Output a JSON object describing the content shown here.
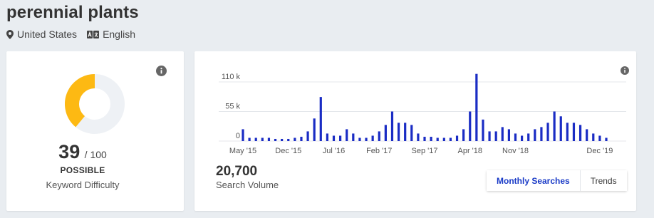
{
  "header": {
    "title": "perennial plants",
    "location": "United States",
    "language": "English"
  },
  "difficulty": {
    "score": "39",
    "out_of": "/ 100",
    "level": "POSSIBLE",
    "caption": "Keyword Difficulty",
    "value_fraction": 0.39,
    "colors": {
      "fill": "#fdb913",
      "track": "#eef1f5"
    }
  },
  "volume": {
    "value": "20,700",
    "caption": "Search Volume",
    "toggle": {
      "monthly_label": "Monthly Searches",
      "trends_label": "Trends",
      "active": "monthly"
    }
  },
  "chart_data": {
    "type": "bar",
    "color": "#1a2cc4",
    "yticks": [
      "110 k",
      "55 k",
      "0"
    ],
    "ytick_values": [
      110000,
      55000,
      0
    ],
    "ylim": [
      0,
      110000
    ],
    "xtick_labels": [
      "May '15",
      "Dec '15",
      "Jul '16",
      "Feb '17",
      "Sep '17",
      "Apr '18",
      "Nov '18",
      "Dec '19"
    ],
    "xtick_indices": [
      0,
      7,
      14,
      21,
      28,
      35,
      42,
      55
    ],
    "values": [
      22000,
      6000,
      6000,
      6000,
      6000,
      4000,
      4000,
      4000,
      6000,
      8000,
      18000,
      42000,
      82000,
      14000,
      10000,
      10000,
      22000,
      14000,
      6000,
      6000,
      10000,
      18000,
      30000,
      55000,
      34000,
      34000,
      30000,
      14000,
      8000,
      8000,
      6000,
      6000,
      6000,
      10000,
      22000,
      55000,
      125000,
      40000,
      18000,
      18000,
      26000,
      22000,
      14000,
      10000,
      14000,
      22000,
      26000,
      34000,
      55000,
      46000,
      34000,
      34000,
      30000,
      22000,
      14000,
      10000,
      6000
    ]
  }
}
